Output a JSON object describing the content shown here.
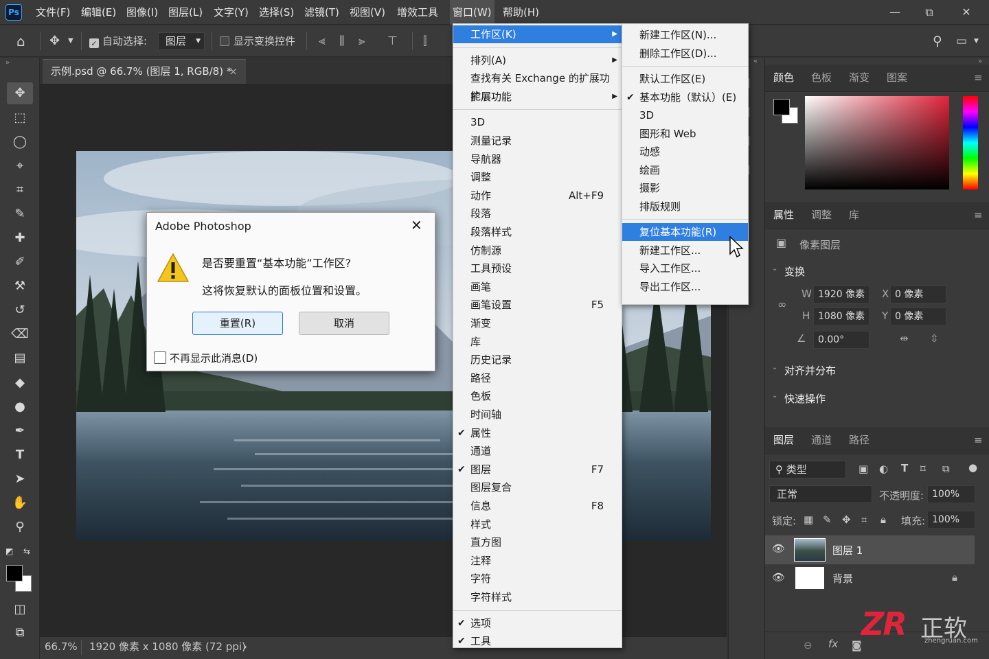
{
  "app": {
    "logo": "Ps"
  },
  "menubar": {
    "items": [
      "文件(F)",
      "编辑(E)",
      "图像(I)",
      "图层(L)",
      "文字(Y)",
      "选择(S)",
      "滤镜(T)",
      "视图(V)",
      "增效工具",
      "窗口(W)",
      "帮助(H)"
    ],
    "window_controls": [
      "—",
      "⧉",
      "✕"
    ]
  },
  "options": {
    "auto_select_label": "自动选择:",
    "auto_select_value": "图层",
    "show_transform_label": "显示变换控件"
  },
  "document": {
    "tab_title": "示例.psd @ 66.7% (图层 1, RGB/8) *",
    "tab_close": "×",
    "zoom": "66.7%",
    "status": "1920 像素 x 1080 像素 (72 ppi)"
  },
  "window_menu": {
    "items": [
      {
        "label": "工作区(K)",
        "submenu": true,
        "highlighted": true
      },
      {
        "sep": true
      },
      {
        "label": "排列(A)",
        "submenu": true
      },
      {
        "label": "查找有关 Exchange 的扩展功能..."
      },
      {
        "label": "扩展功能",
        "submenu": true
      },
      {
        "sep": true
      },
      {
        "label": "3D"
      },
      {
        "label": "测量记录"
      },
      {
        "label": "导航器"
      },
      {
        "label": "调整"
      },
      {
        "label": "动作",
        "shortcut": "Alt+F9"
      },
      {
        "label": "段落"
      },
      {
        "label": "段落样式"
      },
      {
        "label": "仿制源"
      },
      {
        "label": "工具预设"
      },
      {
        "label": "画笔"
      },
      {
        "label": "画笔设置",
        "shortcut": "F5"
      },
      {
        "label": "渐变"
      },
      {
        "label": "库"
      },
      {
        "label": "历史记录"
      },
      {
        "label": "路径"
      },
      {
        "label": "色板"
      },
      {
        "label": "时间轴"
      },
      {
        "label": "属性",
        "checked": true
      },
      {
        "label": "通道"
      },
      {
        "label": "图层",
        "checked": true,
        "shortcut": "F7"
      },
      {
        "label": "图层复合"
      },
      {
        "label": "信息",
        "shortcut": "F8"
      },
      {
        "label": "样式"
      },
      {
        "label": "直方图"
      },
      {
        "label": "注释"
      },
      {
        "label": "字符"
      },
      {
        "label": "字符样式"
      },
      {
        "sep": true
      },
      {
        "label": "选项",
        "checked": true
      },
      {
        "label": "工具",
        "checked": true
      }
    ]
  },
  "workspace_submenu": {
    "items": [
      {
        "label": "新建工作区(N)..."
      },
      {
        "label": "删除工作区(D)..."
      },
      {
        "sep": true
      },
      {
        "label": "默认工作区(E)"
      },
      {
        "label": "基本功能（默认）(E)",
        "checked": true
      },
      {
        "label": "3D"
      },
      {
        "label": "图形和 Web"
      },
      {
        "label": "动感"
      },
      {
        "label": "绘画"
      },
      {
        "label": "摄影"
      },
      {
        "label": "排版规则"
      },
      {
        "sep": true
      },
      {
        "label": "复位基本功能(R)",
        "highlighted": true
      },
      {
        "label": "新建工作区..."
      },
      {
        "label": "导入工作区..."
      },
      {
        "label": "导出工作区..."
      }
    ]
  },
  "dialog": {
    "title": "Adobe Photoshop",
    "question": "是否要重置“基本功能”工作区?",
    "detail": "这将恢复默认的面板位置和设置。",
    "reset_button": "重置(R)",
    "cancel_button": "取消",
    "dont_show": "不再显示此消息(D)"
  },
  "color_panel": {
    "tabs": [
      "颜色",
      "色板",
      "渐变",
      "图案"
    ]
  },
  "properties_panel": {
    "tabs": [
      "属性",
      "调整",
      "库"
    ],
    "kind": "像素图层",
    "transform_title": "变换",
    "w_label": "W",
    "w_value": "1920 像素",
    "h_label": "H",
    "h_value": "1080 像素",
    "x_label": "X",
    "x_value": "0 像素",
    "y_label": "Y",
    "y_value": "0 像素",
    "angle": "0.00°",
    "align_title": "对齐并分布",
    "quick_title": "快速操作"
  },
  "layers_panel": {
    "tabs": [
      "图层",
      "通道",
      "路径"
    ],
    "filter_label": "类型",
    "blend_mode": "正常",
    "opacity_label": "不透明度:",
    "opacity_value": "100%",
    "lock_label": "锁定:",
    "fill_label": "填充:",
    "fill_value": "100%",
    "layers": [
      {
        "name": "图层 1",
        "selected": true
      },
      {
        "name": "背景",
        "locked": true
      }
    ],
    "footer_fx": "fx"
  },
  "watermark": {
    "brand": "ZR",
    "cn": "正软",
    "url": "zhengruan.com"
  },
  "colors": {
    "menu_highlight": "#2f7fe0",
    "ps_blue": "#31a8ff",
    "watermark_red": "#e0243a"
  }
}
